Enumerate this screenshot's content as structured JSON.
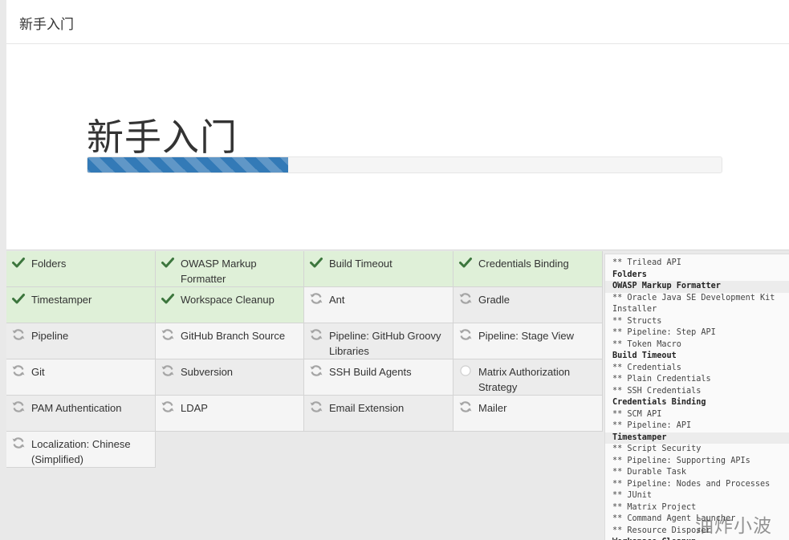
{
  "header": {
    "title": "新手入门"
  },
  "hero": {
    "title": "新手入门",
    "progress": 0.316
  },
  "plugins": [
    {
      "name": "Folders",
      "status": "success"
    },
    {
      "name": "OWASP Markup Formatter",
      "status": "success"
    },
    {
      "name": "Build Timeout",
      "status": "success"
    },
    {
      "name": "Credentials Binding",
      "status": "success"
    },
    {
      "name": "Timestamper",
      "status": "success"
    },
    {
      "name": "Workspace Cleanup",
      "status": "success"
    },
    {
      "name": "Ant",
      "status": "pending"
    },
    {
      "name": "Gradle",
      "status": "pending"
    },
    {
      "name": "Pipeline",
      "status": "pending"
    },
    {
      "name": "GitHub Branch Source",
      "status": "pending"
    },
    {
      "name": "Pipeline: GitHub Groovy Libraries",
      "status": "pending"
    },
    {
      "name": "Pipeline: Stage View",
      "status": "pending"
    },
    {
      "name": "Git",
      "status": "pending"
    },
    {
      "name": "Subversion",
      "status": "pending"
    },
    {
      "name": "SSH Build Agents",
      "status": "pending"
    },
    {
      "name": "Matrix Authorization Strategy",
      "status": "waiting"
    },
    {
      "name": "PAM Authentication",
      "status": "pending"
    },
    {
      "name": "LDAP",
      "status": "pending"
    },
    {
      "name": "Email Extension",
      "status": "pending"
    },
    {
      "name": "Mailer",
      "status": "pending"
    },
    {
      "name": "Localization: Chinese (Simplified)",
      "status": "pending"
    }
  ],
  "log": [
    {
      "text": "** Trilead API",
      "type": "dep"
    },
    {
      "text": "Folders",
      "type": "head"
    },
    {
      "text": "OWASP Markup Formatter",
      "type": "head-hl"
    },
    {
      "text": "** Oracle Java SE Development Kit",
      "type": "dep"
    },
    {
      "text": "Installer",
      "type": "dep"
    },
    {
      "text": "** Structs",
      "type": "dep"
    },
    {
      "text": "** Pipeline: Step API",
      "type": "dep"
    },
    {
      "text": "** Token Macro",
      "type": "dep"
    },
    {
      "text": "Build Timeout",
      "type": "head"
    },
    {
      "text": "** Credentials",
      "type": "dep"
    },
    {
      "text": "** Plain Credentials",
      "type": "dep"
    },
    {
      "text": "** SSH Credentials",
      "type": "dep"
    },
    {
      "text": "Credentials Binding",
      "type": "head"
    },
    {
      "text": "** SCM API",
      "type": "dep"
    },
    {
      "text": "** Pipeline: API",
      "type": "dep"
    },
    {
      "text": "Timestamper",
      "type": "head-hl"
    },
    {
      "text": "** Script Security",
      "type": "dep"
    },
    {
      "text": "** Pipeline: Supporting APIs",
      "type": "dep"
    },
    {
      "text": "** Durable Task",
      "type": "dep"
    },
    {
      "text": "** Pipeline: Nodes and Processes",
      "type": "dep"
    },
    {
      "text": "** JUnit",
      "type": "dep"
    },
    {
      "text": "** Matrix Project",
      "type": "dep"
    },
    {
      "text": "** Command Agent Launcher",
      "type": "dep"
    },
    {
      "text": "** Resource Disposer",
      "type": "dep"
    },
    {
      "text": "Workspace Cleanup",
      "type": "head"
    }
  ],
  "watermark": "油炸小波",
  "colors": {
    "success_bg": "#dff0d8",
    "check": "#3c763d",
    "accent": "#337ab7",
    "pending_icon": "#9a9a9a"
  },
  "icons": {
    "success": "check-icon",
    "pending": "refresh-icon",
    "waiting": "circle-icon"
  }
}
